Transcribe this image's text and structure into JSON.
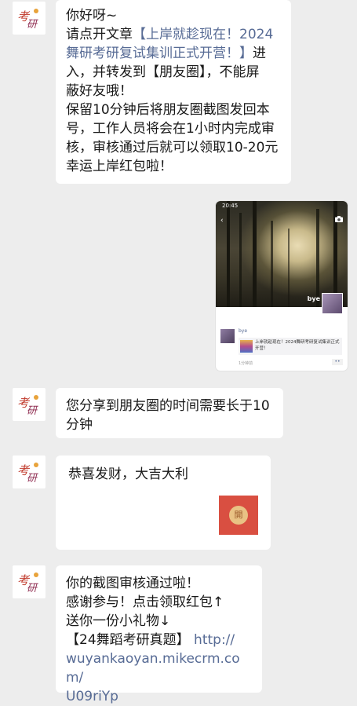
{
  "messages": {
    "m1": {
      "line1": "你好呀~",
      "line2_prefix": "请点开文章",
      "line2_link": "【上岸就趁现在！2024",
      "line3_link": "舞研考研复试集训正式开营！】",
      "line3_suffix": "进",
      "line4": "入，并转发到【朋友圈】，不能屏",
      "line5": "蔽好友哦！",
      "line6": "保留10分钟后将朋友圈截图发回本",
      "line7": "号，工作人员将会在1小时内完成审",
      "line8": "核，审核通过后就可以领取10-20元",
      "line9": "幸运上岸红包啦！"
    },
    "m2": {
      "status_time": "20:45",
      "overlay_name": "bye",
      "post_name": "bye",
      "post_link_text": "上岸就趁现在！2024舞研考研复试集训正式开营！",
      "post_time": "1分钟前",
      "post_dots": "••"
    },
    "m3": {
      "line1": "您分享到朋友圈的时间需要长于10",
      "line2": "分钟"
    },
    "m4": {
      "text": "恭喜发财，大吉大利",
      "packet_char": "開"
    },
    "m5": {
      "line1": "你的截图审核通过啦！",
      "line2": "感谢参与！点击领取红包↑",
      "line3": "送你一份小礼物↓",
      "line4_prefix": "【24舞蹈考研真题】",
      "line4_link": "http://",
      "line5_link": "wuyankaoyan.mikecrm.com/",
      "line6_link": "U09riYp"
    }
  },
  "colors": {
    "background": "#ededed",
    "bubble": "#ffffff",
    "link": "#576b95",
    "red_packet": "#d94f41"
  },
  "icons": [
    "avatar-logo-icon",
    "back-arrow-icon",
    "camera-icon",
    "red-packet-icon"
  ]
}
